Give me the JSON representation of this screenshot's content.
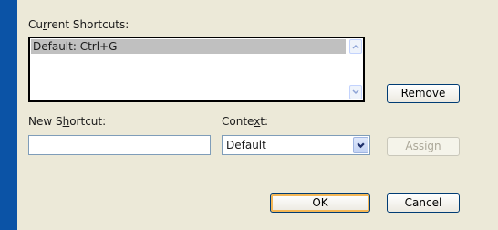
{
  "colors": {
    "desktop_bg": "#0b53a6",
    "dialog_bg": "#ece9d8",
    "selection_bg": "#c0c0c0"
  },
  "current_shortcuts": {
    "label_pre": "Cu",
    "label_key": "r",
    "label_post": "rent Shortcuts:",
    "items": [
      "Default: Ctrl+G"
    ],
    "selected_index": 0
  },
  "remove_button": "Remove",
  "new_shortcut": {
    "label_pre": "New S",
    "label_key": "h",
    "label_post": "ortcut:",
    "value": ""
  },
  "context": {
    "label_pre": "Conte",
    "label_key": "x",
    "label_post": "t:",
    "selected": "Default"
  },
  "assign_button": "Assign",
  "ok_button": "OK",
  "cancel_button": "Cancel",
  "icons": {
    "scroll_up": "chevron-up-icon",
    "scroll_down": "chevron-down-icon",
    "dropdown": "chevron-down-icon"
  }
}
